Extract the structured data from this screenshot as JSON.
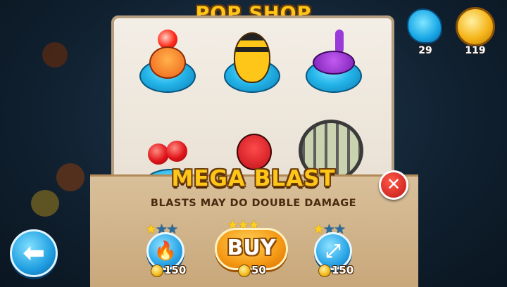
{
  "shop": {
    "title": "POP SHOP"
  },
  "hud": {
    "bloobs": {
      "count": "29",
      "icon": "blue-bloob-icon"
    },
    "coins": {
      "count": "119",
      "icon": "gold-coin-icon"
    }
  },
  "creatures": [
    {
      "name": "fire-fox-bloob"
    },
    {
      "name": "bee-bloob"
    },
    {
      "name": "sunglasses-bug-bloob"
    },
    {
      "name": "cherry-bloob"
    },
    {
      "name": "ladybug-bloob"
    },
    {
      "name": "caged-plant-bloob"
    }
  ],
  "popup": {
    "title": "MEGA BLAST",
    "description": "BLASTS MAY DO DOUBLE DAMAGE",
    "close_icon": "close-icon",
    "buy_label": "BUY",
    "options": [
      {
        "icon": "flame-icon",
        "price": "150",
        "stars_on": 1,
        "stars_total": 3
      },
      {
        "icon": "buy",
        "price": "50",
        "stars_on": 3,
        "stars_total": 3
      },
      {
        "icon": "expand-arrows-icon",
        "price": "150",
        "stars_on": 1,
        "stars_total": 3
      }
    ]
  },
  "nav": {
    "back_icon": "back-arrow-icon"
  },
  "colors": {
    "title_gold": "#ffc61a",
    "outline_brown": "#6b3c0a",
    "blob_blue": "#25b6ea",
    "close_red": "#c01515"
  }
}
